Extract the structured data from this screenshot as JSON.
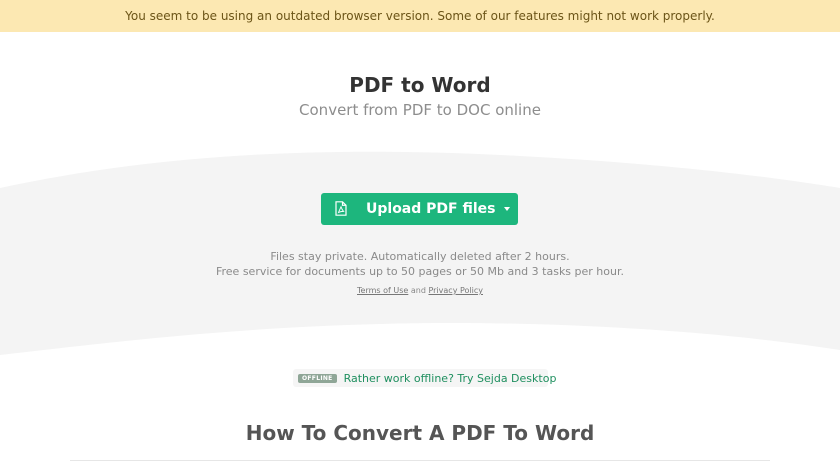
{
  "banner": {
    "text": "You seem to be using an outdated browser version. Some of our features might not work properly."
  },
  "hero": {
    "title": "PDF to Word",
    "subtitle": "Convert from PDF to DOC online"
  },
  "upload": {
    "label": "Upload PDF files"
  },
  "info": {
    "line1": "Files stay private. Automatically deleted after 2 hours.",
    "line2": "Free service for documents up to 50 pages or 50 Mb and 3 tasks per hour.",
    "terms": "Terms of Use",
    "and": "and",
    "privacy": "Privacy Policy"
  },
  "offline": {
    "badge": "OFFLINE",
    "text": "Rather work offline? Try Sejda Desktop"
  },
  "section": {
    "title": "How To Convert A PDF To Word"
  },
  "colors": {
    "accent": "#1db67d",
    "banner_bg": "#fce8b2",
    "wave_bg": "#f4f4f4"
  },
  "icons": {
    "upload": "pdf-file-icon",
    "dropdown": "caret-down-icon",
    "offline_link": "chevron-right-icon"
  }
}
